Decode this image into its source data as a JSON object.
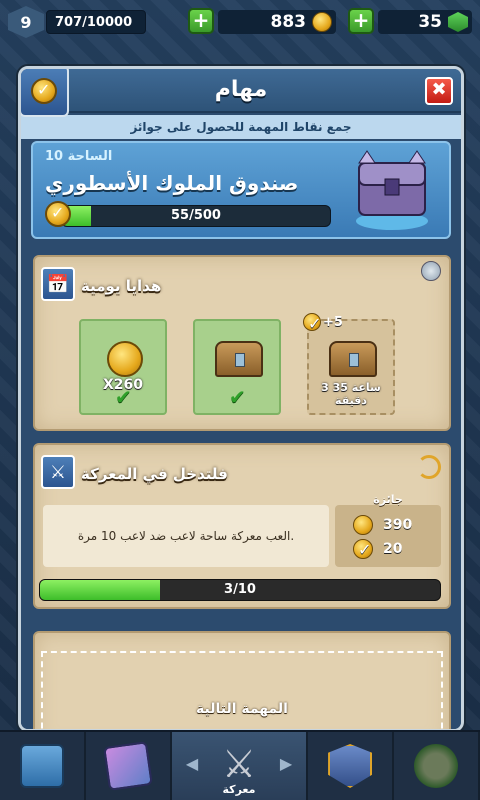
{
  "topbar": {
    "level": "9",
    "xp": "707/10000",
    "gold": "883",
    "gems": "35"
  },
  "modal": {
    "title": "مهام",
    "close": "✖",
    "subtitle": "جمع نقاط المهمة للحصول على جوائز",
    "chest": {
      "arena": "الساحة 10",
      "name": "صندوق الملوك الأسطوري",
      "progress_text": "55/500",
      "progress_fraction": 0.11
    }
  },
  "daily_gifts": {
    "title": "هدايا يومية",
    "tiles": [
      {
        "amount": "X260",
        "state": "done"
      },
      {
        "state": "done"
      },
      {
        "bonus": "+5",
        "timer": "3 ساعة 35 دقيقة",
        "state": "locked"
      }
    ]
  },
  "battle_mission": {
    "title": "فلتدخل في المعركة",
    "description": "العب معركة ساحة لاعب ضد لاعب 10 مرة.",
    "reward_label": "جائزة",
    "reward_gold": "390",
    "reward_points": "20",
    "progress_text": "3/10",
    "progress_fraction": 0.3
  },
  "next_mission": {
    "label": "المهمة التالية"
  },
  "bottom_nav": {
    "active_label": "معركة"
  },
  "colors": {
    "progress_green": "#3dbd2a",
    "close_red": "#c21c14",
    "parchment": "#e2d1b0"
  }
}
